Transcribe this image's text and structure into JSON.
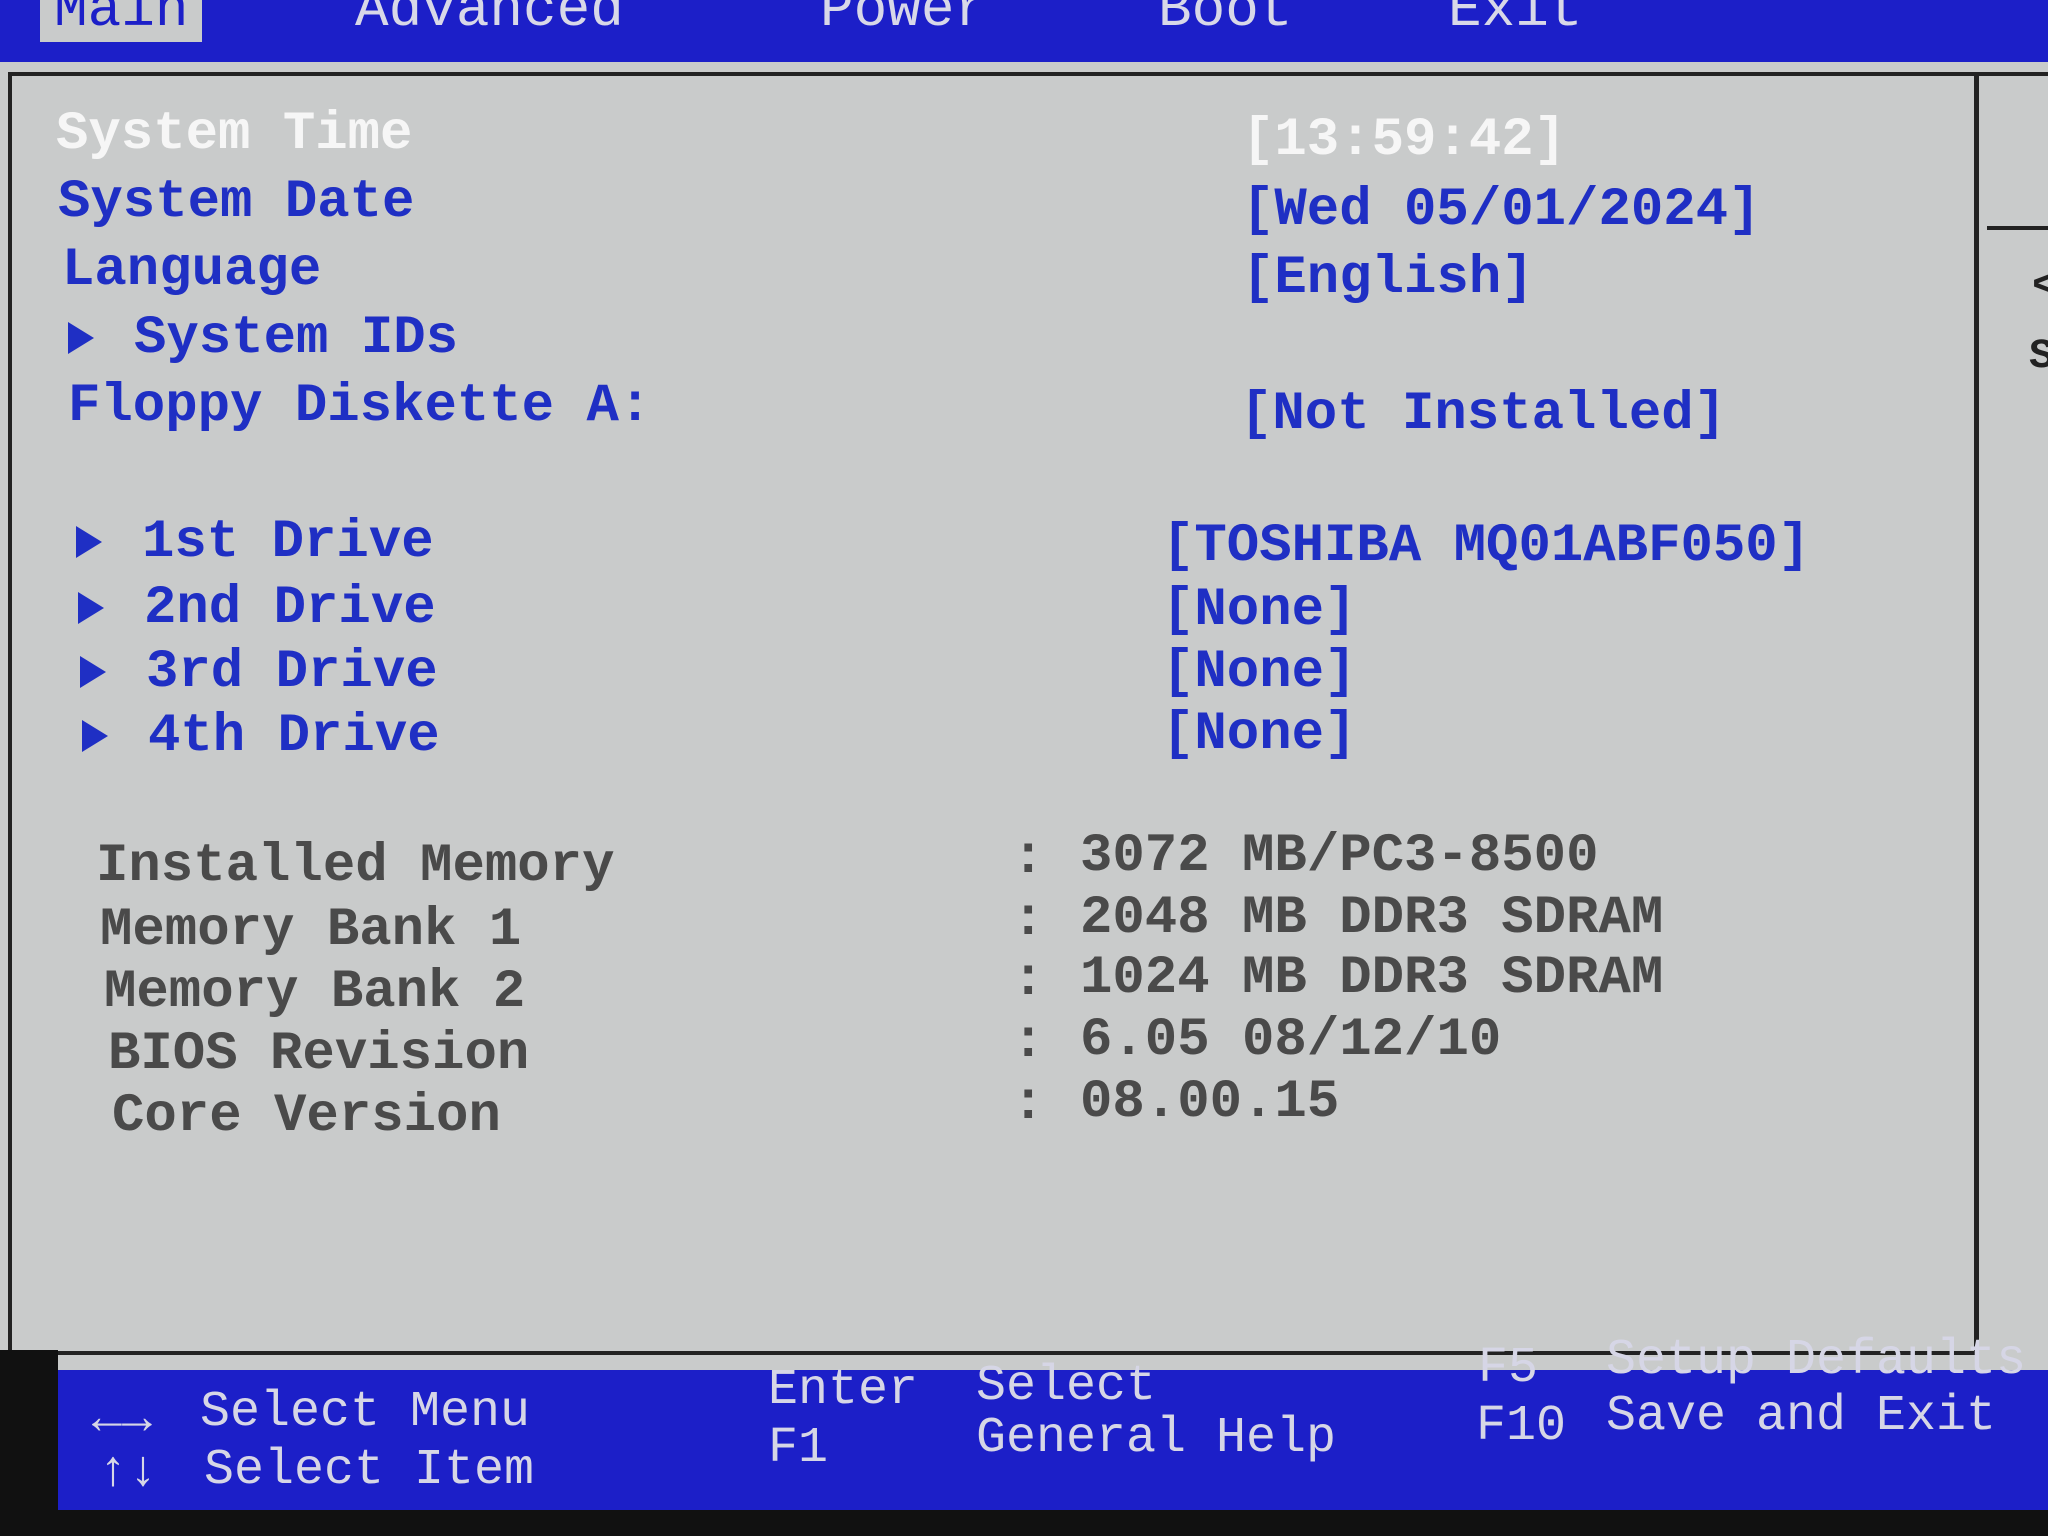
{
  "menu": {
    "items": [
      "Main",
      "Advanced",
      "Power",
      "Boot",
      "Exit"
    ],
    "active": "Main"
  },
  "settings": [
    {
      "label": "System Time",
      "value": "[13:59:42]",
      "selected": true
    },
    {
      "label": "System Date",
      "value": "[Wed 05/01/2024]"
    },
    {
      "label": "Language",
      "value": "[English]"
    },
    {
      "label": "System IDs",
      "value": null,
      "submenu": true
    },
    {
      "label": "Floppy Diskette A:",
      "value": "[Not Installed]"
    }
  ],
  "drives": [
    {
      "label": "1st Drive",
      "value": "[TOSHIBA MQ01ABF050]"
    },
    {
      "label": "2nd Drive",
      "value": "[None]"
    },
    {
      "label": "3rd Drive",
      "value": "[None]"
    },
    {
      "label": "4th Drive",
      "value": "[None]"
    }
  ],
  "info": [
    {
      "label": "Installed Memory",
      "value": "3072 MB/PC3-8500"
    },
    {
      "label": "Memory Bank 1",
      "value": "2048 MB DDR3 SDRAM"
    },
    {
      "label": "Memory Bank 2",
      "value": "1024 MB DDR3 SDRAM"
    },
    {
      "label": "BIOS Revision",
      "value": "6.05 08/12/10"
    },
    {
      "label": "Core Version",
      "value": "08.00.15"
    }
  ],
  "help_panel": {
    "arrow": "<",
    "text": "S"
  },
  "footer": {
    "select_menu_key": "←→",
    "select_menu": "Select Menu",
    "select_item_key": "↑↓",
    "select_item": "Select Item",
    "enter_key": "Enter",
    "enter": "Select",
    "f1_key": "F1",
    "f1": "General Help",
    "f5_key": "F5",
    "f5": "Setup Defaults",
    "f10_key": "F10",
    "f10": "Save and Exit"
  },
  "colors": {
    "menu_bg": "#1c1fc8",
    "panel_bg": "#c9cbcb",
    "item_text": "#1f2fc4",
    "selected_text": "#f6f6f6",
    "info_text": "#4a4a4a"
  }
}
